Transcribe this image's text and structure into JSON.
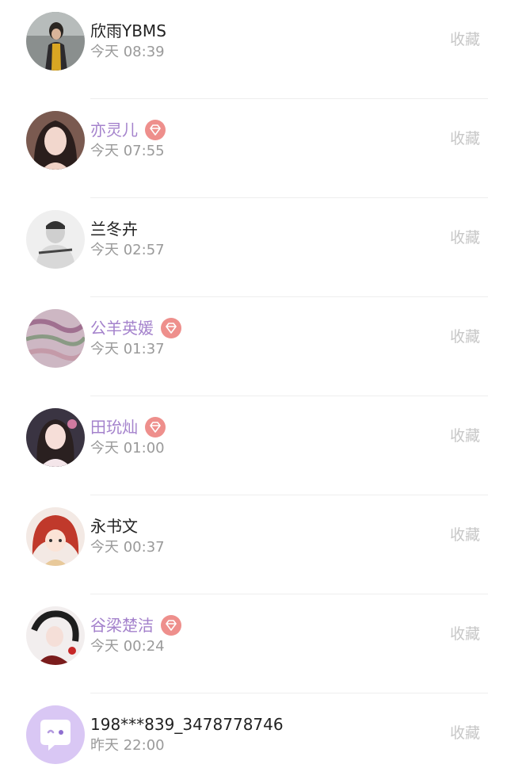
{
  "items": [
    {
      "name": "欣雨YBMS",
      "time": "今天 08:39",
      "action": "收藏",
      "vip": false,
      "avatar": "avatar-photo-woman-yellow-scarf"
    },
    {
      "name": "亦灵儿",
      "time": "今天 07:55",
      "action": "收藏",
      "vip": true,
      "avatar": "avatar-photo-woman-long-hair"
    },
    {
      "name": "兰冬卉",
      "time": "今天 02:57",
      "action": "收藏",
      "vip": false,
      "avatar": "avatar-sketch-man"
    },
    {
      "name": "公羊英媛",
      "time": "今天 01:37",
      "action": "收藏",
      "vip": true,
      "avatar": "avatar-abstract-pattern"
    },
    {
      "name": "田玧灿",
      "time": "今天 01:00",
      "action": "收藏",
      "vip": true,
      "avatar": "avatar-photo-girl"
    },
    {
      "name": "永书文",
      "time": "今天 00:37",
      "action": "收藏",
      "vip": false,
      "avatar": "avatar-anime-red-hair"
    },
    {
      "name": "谷梁楚洁",
      "time": "今天 00:24",
      "action": "收藏",
      "vip": true,
      "avatar": "avatar-ink-drawing"
    },
    {
      "name": "198***839_3478778746",
      "time": "昨天 22:00",
      "action": "收藏",
      "vip": false,
      "avatar": "default-chat-bubble-avatar-icon"
    }
  ],
  "colors": {
    "vip_name": "#a482cc",
    "vip_badge": "#ee8f8c",
    "default_avatar": "#d9c7f4",
    "favorite_text": "#c7c7c7"
  }
}
